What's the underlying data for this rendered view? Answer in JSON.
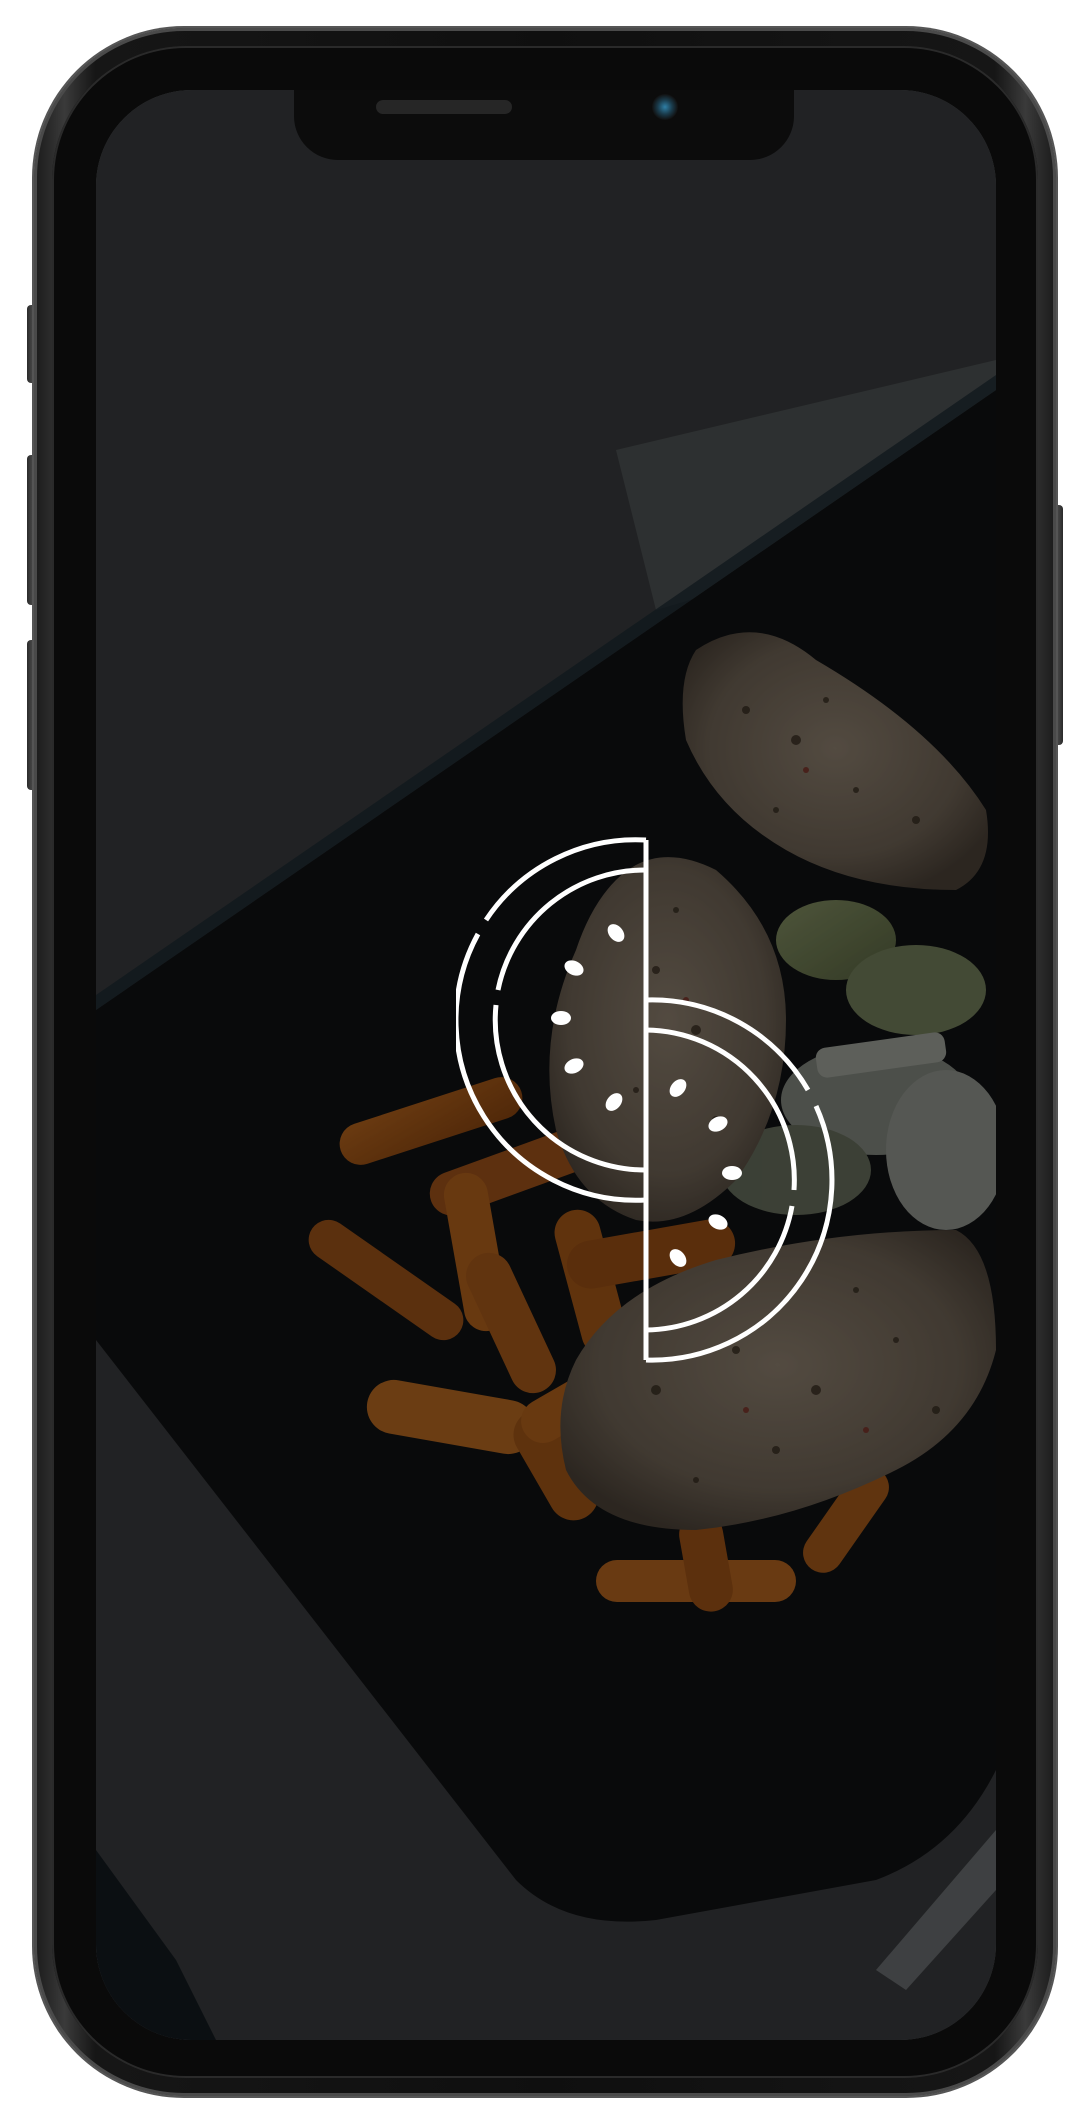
{
  "app": {
    "screen": "splash",
    "logo_icon": "watermelon-slices-logo-icon",
    "background_image": "grilled-chicken-with-carrots-and-leeks-on-dark-plate-photo"
  },
  "colors": {
    "overlay": "#000000",
    "logo_stroke": "#ffffff",
    "phone_frame": "#111111"
  }
}
